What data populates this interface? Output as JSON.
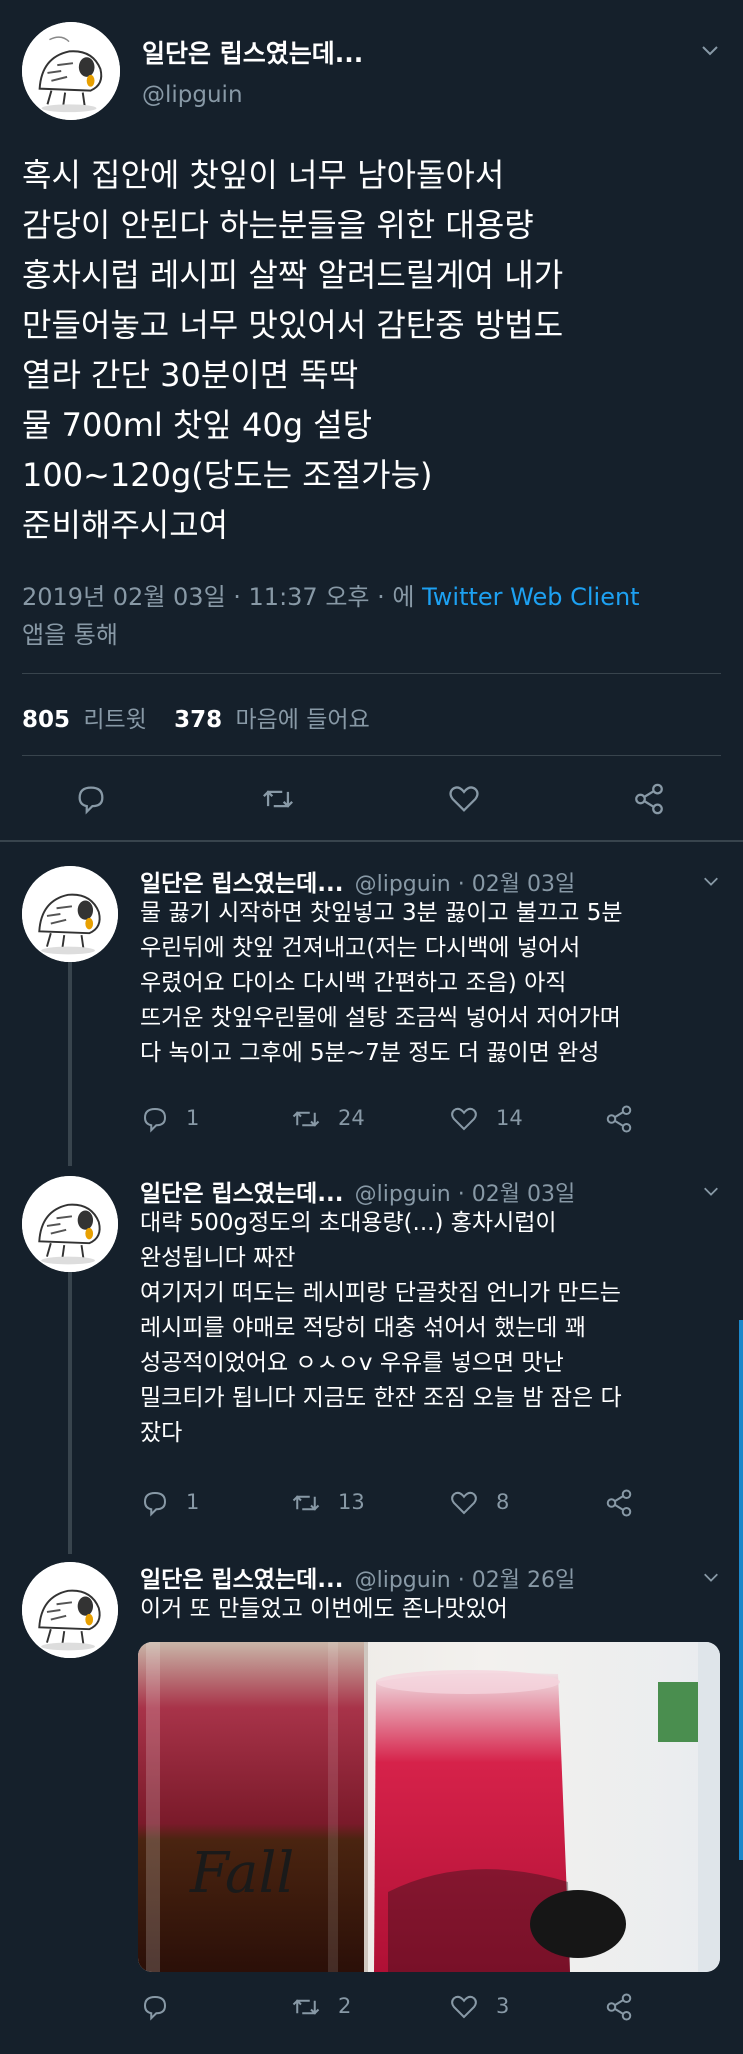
{
  "main_tweet": {
    "display_name": "일단은 립스였는데...",
    "handle": "@lipguin",
    "text": "혹시 집안에 찻잎이 너무 남아돌아서\n감당이 안된다 하는분들을 위한 대용량\n홍차시럽 레시피 살짝 알려드릴게여 내가\n만들어놓고 너무 맛있어서 감탄중 방법도\n열라 간단 30분이면 뚝딱\n물 700ml 찻잎 40g 설탕\n100~120g(당도는 조절가능)\n준비해주시고여",
    "timestamp": "2019년 02월 03일 · 11:37 오후 · 에 ",
    "client": "Twitter Web Client",
    "via_suffix": "앱을 통해",
    "retweets_count": "805",
    "retweets_label": "리트윗",
    "likes_count": "378",
    "likes_label": "마음에 들어요"
  },
  "replies": [
    {
      "display_name": "일단은 립스였는데...",
      "handle_date": "@lipguin · 02월 03일",
      "text": "물 끓기 시작하면 찻잎넣고 3분 끓이고 불끄고 5분\n우린뒤에 찻잎 건져내고(저는 다시백에 넣어서\n우렸어요 다이소 다시백 간편하고 조음) 아직\n뜨거운 찻잎우린물에 설탕 조금씩 넣어서 저어가며\n다 녹이고 그후에 5분~7분 정도 더 끓이면 완성",
      "replies": "1",
      "retweets": "24",
      "likes": "14"
    },
    {
      "display_name": "일단은 립스였는데...",
      "handle_date": "@lipguin · 02월 03일",
      "text": "대략 500g정도의 초대용량(...) 홍차시럽이\n완성됩니다 짜잔\n여기저기 떠도는 레시피랑 단골찻집 언니가 만드는\n레시피를 야매로 적당히 대충 섞어서 했는데 꽤\n성공적이었어요 ㅇㅅㅇv 우유를 넣으면 맛난\n밀크티가 됩니다 지금도 한잔 조짐 오늘 밤 잠은 다\n잤다",
      "replies": "1",
      "retweets": "13",
      "likes": "8"
    },
    {
      "display_name": "일단은 립스였는데...",
      "handle_date": "@lipguin · 02월 26일",
      "text": "이거 또 만들었고 이번에도 존나맛있어",
      "replies": "",
      "retweets": "2",
      "likes": "3",
      "photo_label": "Fall"
    }
  ],
  "colors": {
    "background": "#15202b",
    "text": "#ffffff",
    "muted": "#8899a6",
    "link": "#1da1f2",
    "divider": "#38444d"
  },
  "icons": [
    "chevron-down-icon",
    "reply-icon",
    "retweet-icon",
    "like-icon",
    "share-icon"
  ]
}
